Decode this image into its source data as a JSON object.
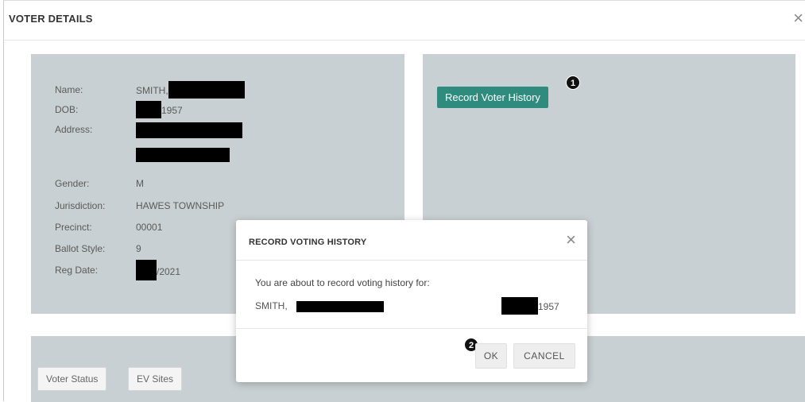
{
  "modal": {
    "title": "VOTER DETAILS",
    "close_glyph": "×"
  },
  "voter": {
    "rows": [
      {
        "label": "Name:",
        "value": "SMITH,"
      },
      {
        "label": "DOB:",
        "value": "1957"
      },
      {
        "label": "Address:",
        "value": ""
      },
      {
        "label": "Gender:",
        "value": "M"
      },
      {
        "label": "Jurisdiction:",
        "value": "HAWES TOWNSHIP"
      },
      {
        "label": "Precinct:",
        "value": "00001"
      },
      {
        "label": "Ballot Style:",
        "value": "9"
      },
      {
        "label": "Reg Date:",
        "value": "/2021"
      }
    ]
  },
  "actions": {
    "record_label": "Record Voter History",
    "step1": "1",
    "step2": "2"
  },
  "tabs": {
    "voter_status": "Voter Status",
    "ev_sites": "EV Sites"
  },
  "dialog": {
    "title": "RECORD VOTING HISTORY",
    "close_glyph": "×",
    "message": "You are about to record voting history for:",
    "name": "SMITH,",
    "dob": "1957",
    "ok_label": "OK",
    "cancel_label": "CANCEL"
  },
  "colors": {
    "panel_bg": "#c9d0d3",
    "accent": "#2e8b7e"
  },
  "icons": {
    "close": "close-icon",
    "step_badge": "numbered-step-badge"
  }
}
